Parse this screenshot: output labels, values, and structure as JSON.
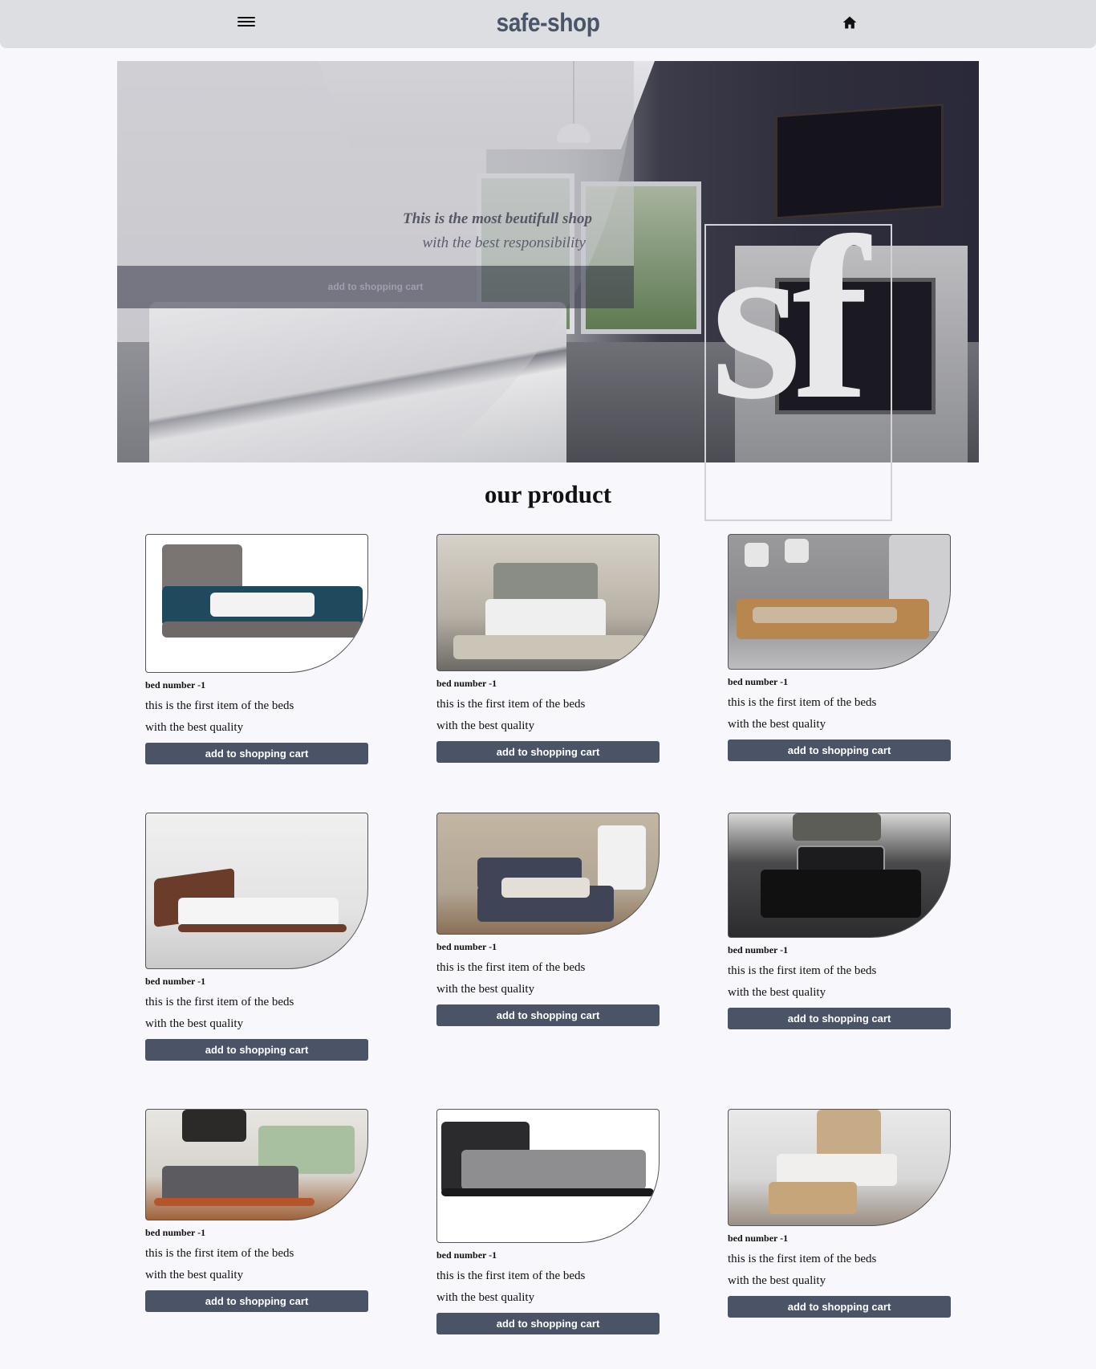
{
  "header": {
    "brand": "safe-shop",
    "menu_icon": "hamburger-menu-icon",
    "home_icon": "home-icon"
  },
  "hero": {
    "tagline_1": "This is the most beutifull shop",
    "tagline_2": "with the best responsibility",
    "cta_label": "add to shopping cart",
    "logo": "sf"
  },
  "products": {
    "title": "our product",
    "items": [
      {
        "name": "bed number -1",
        "line1": "this is the first item of the beds",
        "line2": "with the best quality",
        "cta": "add to shopping cart"
      },
      {
        "name": "bed number -1",
        "line1": "this is the first item of the beds",
        "line2": "with the best quality",
        "cta": "add to shopping cart"
      },
      {
        "name": "bed number -1",
        "line1": "this is the first item of the beds",
        "line2": "with the best quality",
        "cta": "add to shopping cart"
      },
      {
        "name": "bed number -1",
        "line1": "this is the first item of the beds",
        "line2": "with the best quality",
        "cta": "add to shopping cart"
      },
      {
        "name": "bed number -1",
        "line1": "this is the first item of the beds",
        "line2": "with the best quality",
        "cta": "add to shopping cart"
      },
      {
        "name": "bed number -1",
        "line1": "this is the first item of the beds",
        "line2": "with the best quality",
        "cta": "add to shopping cart"
      },
      {
        "name": "bed number -1",
        "line1": "this is the first item of the beds",
        "line2": "with the best quality",
        "cta": "add to shopping cart"
      },
      {
        "name": "bed number -1",
        "line1": "this is the first item of the beds",
        "line2": "with the best quality",
        "cta": "add to shopping cart"
      },
      {
        "name": "bed number -1",
        "line1": "this is the first item of the beds",
        "line2": "with the best quality",
        "cta": "add to shopping cart"
      }
    ]
  },
  "colors": {
    "header_bg": "#dcdee2",
    "brand_text": "#4a5568",
    "button_bg": "#4a5466",
    "page_bg": "#f8f8fc"
  }
}
